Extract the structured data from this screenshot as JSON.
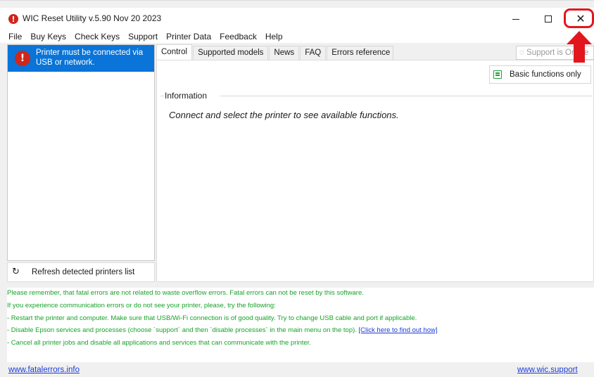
{
  "window": {
    "title": "WIC Reset Utility v.5.90 Nov 20 2023",
    "accent_color": "#0a74d8",
    "highlight_color": "#e3161e"
  },
  "menu": {
    "items": [
      "File",
      "Buy Keys",
      "Check Keys",
      "Support",
      "Printer Data",
      "Feedback",
      "Help"
    ]
  },
  "printers": {
    "selected_message": "Printer must be connected via USB or network.",
    "alert_icon": "!",
    "refresh_label": "Refresh detected printers list"
  },
  "tabs": {
    "items": [
      "Control",
      "Supported models",
      "News",
      "FAQ",
      "Errors reference"
    ],
    "active": "Control"
  },
  "support_status": "Support is Online",
  "control": {
    "basic_functions_label": "Basic functions only",
    "info_group_label": "Information",
    "info_message": "Connect and select the printer to see available functions."
  },
  "log": {
    "line1": "Please remember, that fatal errors are not related to waste overflow errors. Fatal errors can not be reset by this software.",
    "line2": "If you experience communication errors or do not see your printer, please, try the following:",
    "line3": "- Restart the printer and computer. Make sure that USB/Wi-Fi connection is of good quality. Try to change USB cable and port if applicable.",
    "line4": "- Disable Epson services and processes (choose `support` and then `disable processes` in the main menu on the top). ",
    "line4_link": "[Click here to find out how]",
    "line5": "- Cancel all printer jobs and disable all applications and services that can communicate with the printer.",
    "text_color": "#17a329"
  },
  "footer": {
    "left_link": "www.fatalerrors.info",
    "right_link": "www.wic.support"
  }
}
